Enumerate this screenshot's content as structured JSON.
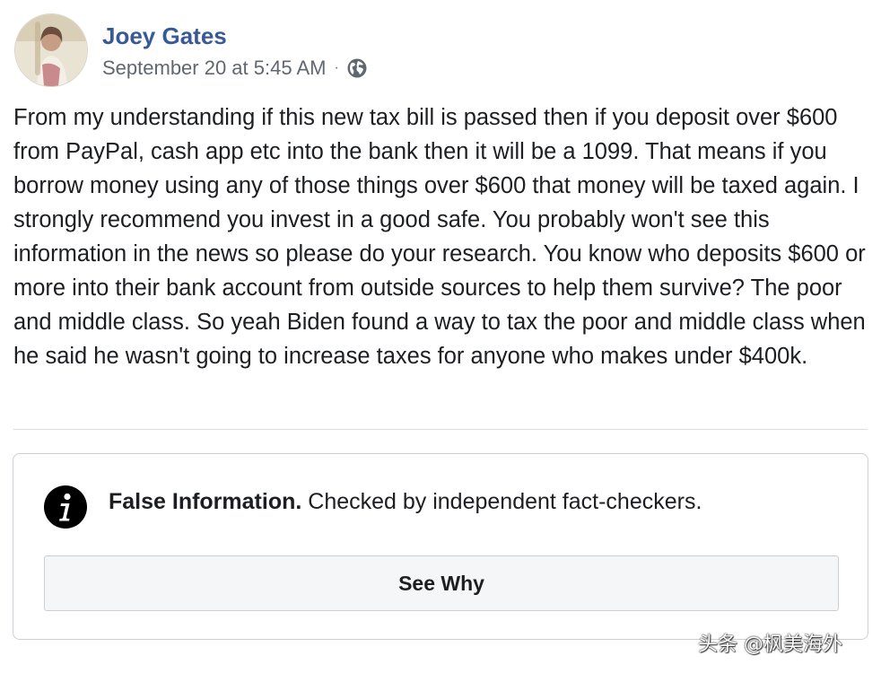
{
  "post": {
    "author": "Joey Gates",
    "timestamp": "September 20 at 5:45 AM",
    "separator": "·",
    "audience_icon": "globe-icon",
    "body": "From my understanding if this new tax bill is passed then if you deposit over $600 from PayPal, cash app etc into the bank then it will be a 1099. That means if you borrow money using any of those things over $600 that money will be taxed again. I strongly recommend you invest in a good safe. You probably won't see this information in the news so please do your research. You know who deposits $600 or more into their bank account from outside sources to help them survive? The poor and middle class. So yeah Biden found a way to tax the poor and middle class when he said he wasn't going to increase taxes for anyone who makes under $400k."
  },
  "fact_check": {
    "icon": "info-icon",
    "label": "False Information.",
    "description": " Checked by independent fact-checkers.",
    "button_label": "See Why"
  },
  "watermark": "头条 @枫美海外",
  "colors": {
    "author_link": "#385898",
    "text": "#1c1e21",
    "secondary_text": "#616770",
    "border": "#ccd0d5",
    "button_bg": "#f5f6f7"
  }
}
